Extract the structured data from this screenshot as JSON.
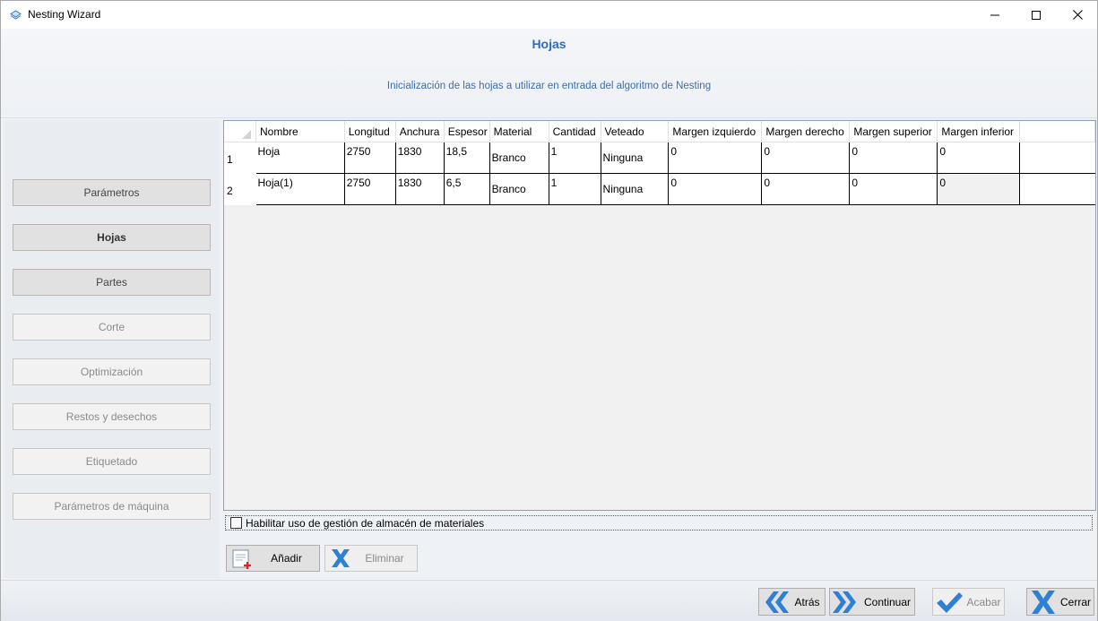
{
  "window": {
    "title": "Nesting Wizard"
  },
  "header": {
    "title": "Hojas",
    "subtitle": "Inicialización de las hojas a utilizar en entrada del algoritmo de Nesting"
  },
  "sidebar": {
    "items": [
      {
        "label": "Parámetros",
        "state": "enabled"
      },
      {
        "label": "Hojas",
        "state": "active"
      },
      {
        "label": "Partes",
        "state": "enabled"
      },
      {
        "label": "Corte",
        "state": "disabled"
      },
      {
        "label": "Optimización",
        "state": "disabled"
      },
      {
        "label": "Restos y desechos",
        "state": "disabled"
      },
      {
        "label": "Etiquetado",
        "state": "disabled"
      },
      {
        "label": "Parámetros de máquina",
        "state": "disabled"
      }
    ]
  },
  "grid": {
    "columns": [
      "Nombre",
      "Longitud",
      "Anchura",
      "Espesor",
      "Material",
      "Cantidad",
      "Veteado",
      "Margen izquierdo",
      "Margen derecho",
      "Margen superior",
      "Margen inferior"
    ],
    "rows": [
      {
        "index": "1",
        "cells": [
          "Hoja",
          "2750",
          "1830",
          "18,5",
          "Branco",
          "1",
          "Ninguna",
          "0",
          "0",
          "0",
          "0"
        ]
      },
      {
        "index": "2",
        "cells": [
          "Hoja(1)",
          "2750",
          "1830",
          "6,5",
          "Branco",
          "1",
          "Ninguna",
          "0",
          "0",
          "0",
          "0"
        ]
      }
    ]
  },
  "storage_checkbox": {
    "label": "Habilitar uso de gestión de almacén de materiales",
    "checked": false
  },
  "actions": {
    "add_label": "Añadir",
    "delete_label": "Eliminar"
  },
  "footer": {
    "back_label": "Atrás",
    "continue_label": "Continuar",
    "finish_label": "Acabar",
    "close_label": "Cerrar"
  },
  "colors": {
    "accent": "#2d6cc3",
    "nav_arrow": "#2f7fd4",
    "add_plus": "#e0202a"
  }
}
